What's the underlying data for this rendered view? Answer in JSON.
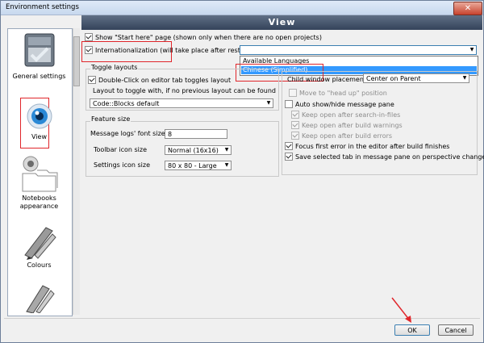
{
  "window": {
    "title": "Environment settings",
    "close_glyph": "✕"
  },
  "banner": {
    "title": "View"
  },
  "sidebar": {
    "items": [
      {
        "label": "General settings",
        "icon": "general-settings-icon"
      },
      {
        "label": "View",
        "icon": "eye-icon",
        "selected": true
      },
      {
        "label": "Notebooks appearance",
        "icon": "notebooks-icon"
      },
      {
        "label": "Colours",
        "icon": "colours-icon"
      },
      {
        "label": "",
        "icon": "brushes-icon"
      }
    ]
  },
  "options": {
    "show_start_here": "Show \"Start here\" page (shown only when there are no open projects)",
    "internationalization": "Internationalization (will take place after restart)"
  },
  "language_dropdown": {
    "value": "",
    "options": [
      "Available Languages",
      "Chinese (Simplified)"
    ],
    "highlighted": "Chinese (Simplified)"
  },
  "toggle_layouts": {
    "heading": "Toggle layouts",
    "double_click": "Double-Click on editor tab toggles layout",
    "layout_label": "Layout to toggle with, if no previous layout can be found",
    "layout_value": "Code::Blocks default"
  },
  "feature_size": {
    "heading": "Feature size",
    "logs_font_label": "Message logs' font size:",
    "logs_font_value": "8",
    "toolbar_label": "Toolbar icon size",
    "toolbar_value": "Normal (16x16)",
    "settings_label": "Settings icon size",
    "settings_value": "80 x 80 - Large"
  },
  "right_panel": {
    "child_window_label": "Child window placement",
    "child_window_value": "Center on Parent",
    "move_head_up": "Move to \"head up\" position",
    "auto_show_hide": "Auto show/hide message pane",
    "keep_open_search": "Keep open after search-in-files",
    "keep_open_warnings": "Keep open after build warnings",
    "keep_open_errors": "Keep open after build errors",
    "focus_first_error": "Focus first error in the editor after build finishes",
    "save_selected_tab": "Save selected tab in message pane on perspective change"
  },
  "buttons": {
    "ok": "OK",
    "cancel": "Cancel"
  },
  "colors": {
    "highlight": "#e0262b",
    "selection": "#3399ff",
    "banner": "#3e4d63"
  }
}
